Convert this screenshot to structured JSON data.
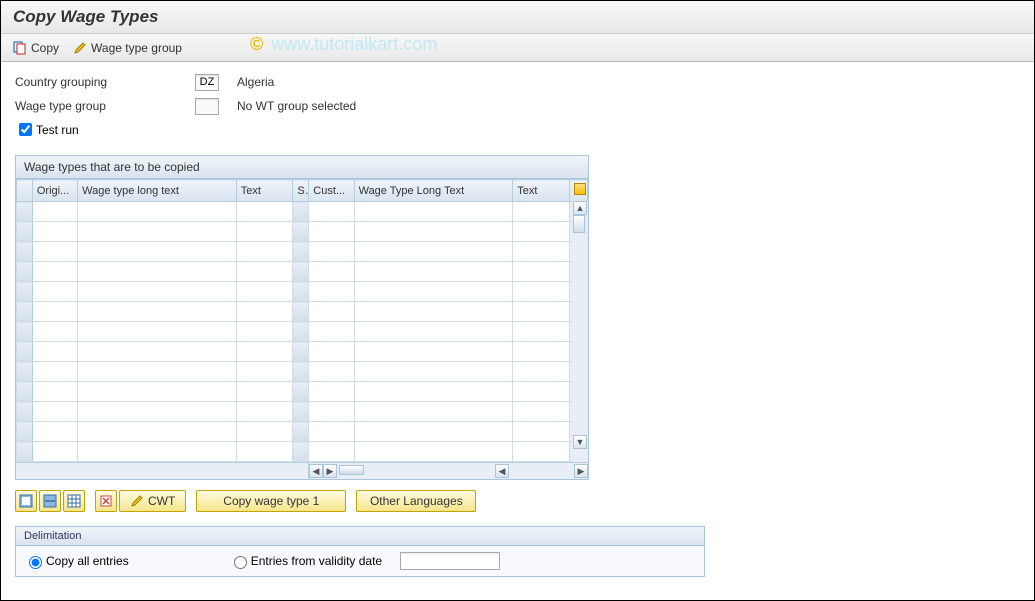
{
  "title": "Copy Wage Types",
  "toolbar": {
    "copy_label": "Copy",
    "wtgroup_label": "Wage type group"
  },
  "form": {
    "country_label": "Country grouping",
    "country_value": "DZ",
    "country_name": "Algeria",
    "wtgroup_label": "Wage type group",
    "wtgroup_value": "",
    "wtgroup_name": "No WT group selected",
    "testrun_label": "Test run",
    "testrun_checked": true
  },
  "table": {
    "panel_title": "Wage types that are to be copied",
    "columns": [
      "Origi...",
      "Wage type long text",
      "Text",
      "S",
      "Cust...",
      "Wage Type Long Text",
      "Text"
    ],
    "row_count": 13
  },
  "buttons": {
    "cwt": "CWT",
    "copy_one": "Copy wage type 1",
    "other_lang": "Other Languages"
  },
  "delimitation": {
    "title": "Delimitation",
    "opt_all": "Copy all entries",
    "opt_from": "Entries from validity date",
    "selected": "all",
    "date_value": ""
  },
  "watermark": "www.tutorialkart.com"
}
